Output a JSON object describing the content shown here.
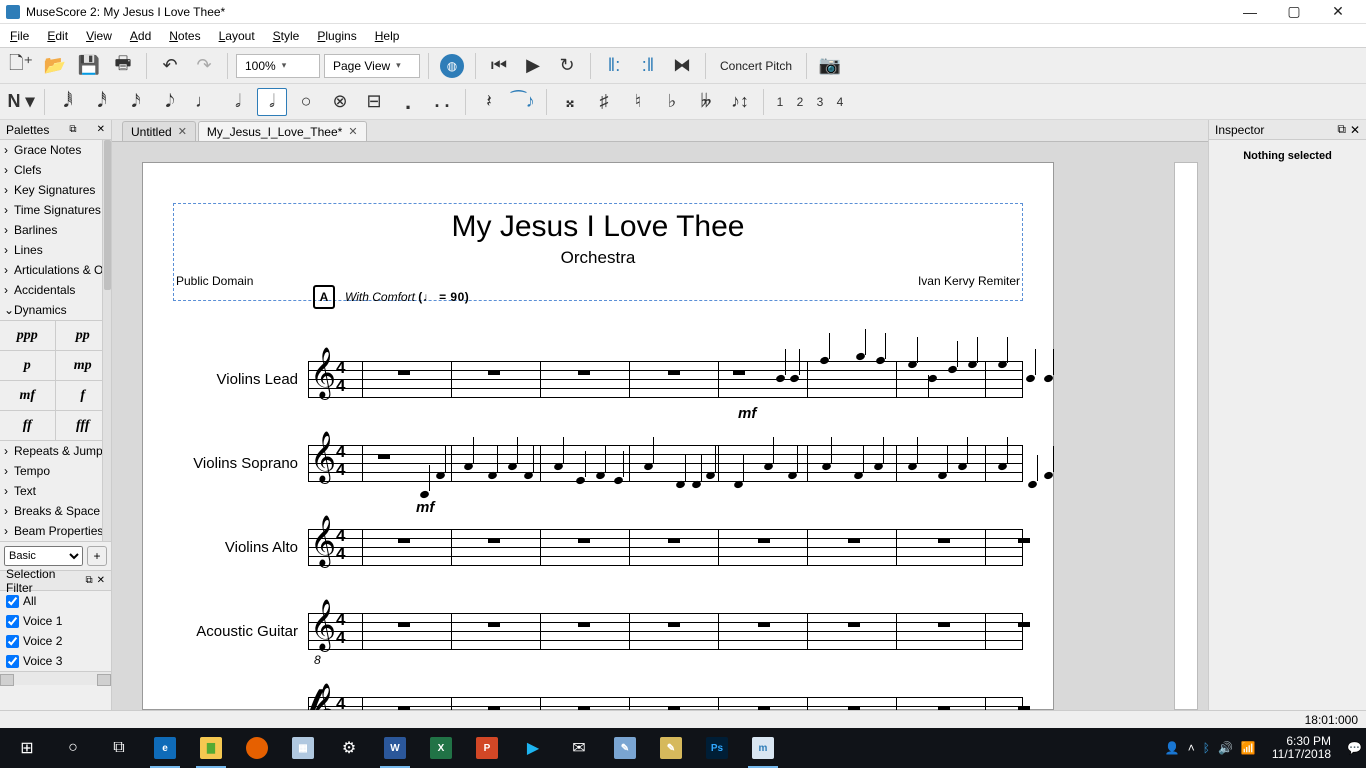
{
  "window": {
    "title": "MuseScore 2: My Jesus I Love Thee*"
  },
  "menu": [
    "File",
    "Edit",
    "View",
    "Add",
    "Notes",
    "Layout",
    "Style",
    "Plugins",
    "Help"
  ],
  "toolbar": {
    "zoom": "100%",
    "view": "Page View",
    "concert_pitch": "Concert Pitch",
    "voices": [
      "1",
      "2",
      "3",
      "4"
    ]
  },
  "palettes": {
    "title": "Palettes",
    "items": [
      "Grace Notes",
      "Clefs",
      "Key Signatures",
      "Time Signatures",
      "Barlines",
      "Lines",
      "Articulations & O",
      "Accidentals",
      "Dynamics"
    ],
    "dynamics": [
      "ppp",
      "pp",
      "p",
      "mp",
      "mf",
      "f",
      "ff",
      "fff"
    ],
    "items2": [
      "Repeats & Jump",
      "Tempo",
      "Text",
      "Breaks & Space",
      "Beam Properties"
    ],
    "workspace": "Basic"
  },
  "selection_filter": {
    "title": "Selection Filter",
    "items": [
      "All",
      "Voice 1",
      "Voice 2",
      "Voice 3"
    ]
  },
  "tabs": [
    {
      "label": "Untitled",
      "active": false
    },
    {
      "label": "My_Jesus_I_Love_Thee*",
      "active": true
    }
  ],
  "score": {
    "title": "My Jesus I Love Thee",
    "subtitle": "Orchestra",
    "left_text": "Public Domain",
    "right_text": "Ivan Kervy Remiter",
    "rehearsal": "A",
    "tempo_text": "With Comfort",
    "tempo_bpm": "(♩ = 90)",
    "instruments": [
      "Violins Lead",
      "Violins Soprano",
      "Violins Alto",
      "Acoustic Guitar",
      ""
    ],
    "dyn1": "mf",
    "dyn2": "mf"
  },
  "inspector": {
    "title": "Inspector",
    "body": "Nothing selected"
  },
  "statusbar": {
    "pos": "18:01:000"
  },
  "taskbar": {
    "time": "6:30 PM",
    "date": "11/17/2018"
  }
}
